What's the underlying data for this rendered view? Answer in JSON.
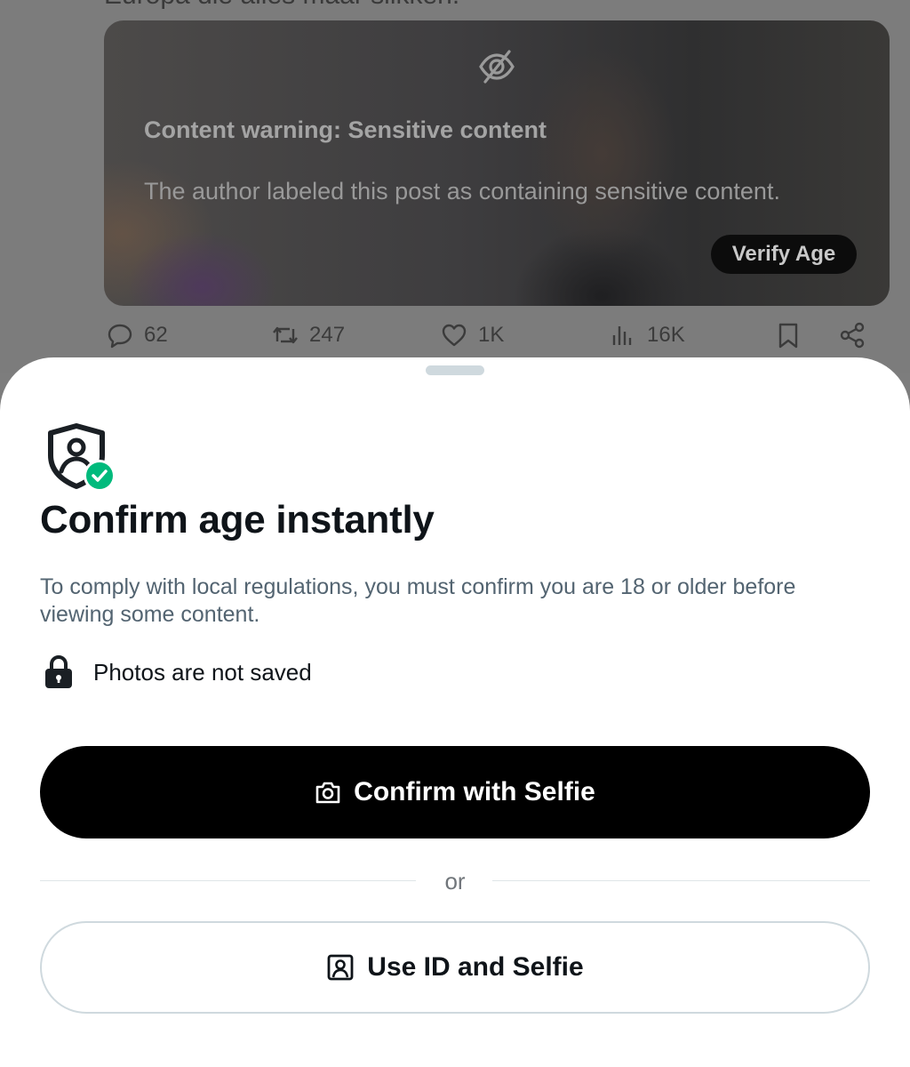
{
  "feed": {
    "top_text": "Europa die alles maar slikken.",
    "content_warning": {
      "title": "Content warning: Sensitive content",
      "body": "The author labeled this post as containing sensitive content.",
      "verify_button": "Verify Age",
      "icon": "eye-off-icon"
    },
    "actions": {
      "replies": "62",
      "reposts": "247",
      "likes": "1K",
      "views": "16K"
    }
  },
  "sheet": {
    "icon": "shield-person-check-icon",
    "title": "Confirm age instantly",
    "description": "To comply with local regulations, you must confirm you are 18 or older before viewing some content.",
    "privacy_note": "Photos are not saved",
    "primary_button": "Confirm with Selfie",
    "divider_text": "or",
    "secondary_button": "Use ID and Selfie"
  },
  "colors": {
    "sheet_background": "#ffffff",
    "primary_button": "#000000",
    "check_badge": "#00ba7c",
    "secondary_text": "#536471",
    "overlay": "#7d7d7d"
  }
}
